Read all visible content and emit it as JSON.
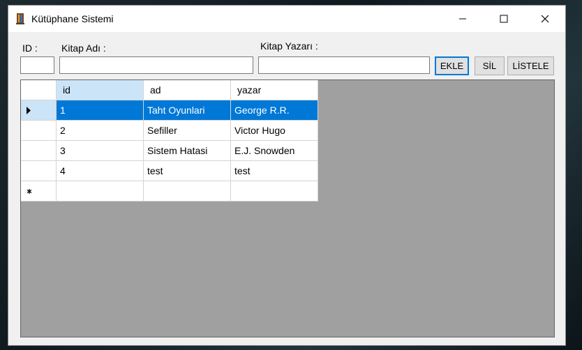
{
  "window": {
    "title": "Kütüphane Sistemi"
  },
  "form": {
    "id_label": "ID :",
    "name_label": "Kitap Adı :",
    "author_label": "Kitap Yazarı :",
    "id_value": "",
    "name_value": "",
    "author_value": "",
    "add_button": "EKLE",
    "delete_button": "SİL",
    "list_button": "LİSTELE"
  },
  "grid": {
    "columns": [
      "id",
      "ad",
      "yazar"
    ],
    "rows": [
      [
        "1",
        "Taht Oyunlari",
        "George R.R."
      ],
      [
        "2",
        "Sefiller",
        "Victor Hugo"
      ],
      [
        "3",
        "Sistem Hatasi",
        "E.J. Snowden"
      ],
      [
        "4",
        "test",
        "test"
      ]
    ],
    "selected_row": 0
  },
  "colors": {
    "accent": "#0078d7",
    "header_active": "#cce4f7",
    "grid_background": "#a0a0a0"
  }
}
